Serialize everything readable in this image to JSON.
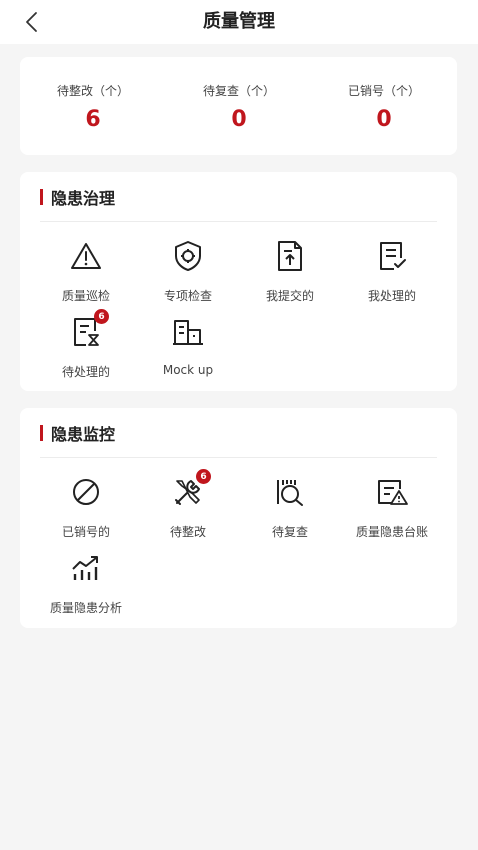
{
  "nav": {
    "title": "质量管理"
  },
  "stats": [
    {
      "label": "待整改（个）",
      "value": "6"
    },
    {
      "label": "待复查（个）",
      "value": "0"
    },
    {
      "label": "已销号（个）",
      "value": "0"
    }
  ],
  "governance": {
    "title": "隐患治理",
    "items": [
      {
        "label": "质量巡检",
        "icon": "warning-triangle-icon"
      },
      {
        "label": "专项检查",
        "icon": "shield-target-icon"
      },
      {
        "label": "我提交的",
        "icon": "document-upload-icon"
      },
      {
        "label": "我处理的",
        "icon": "document-check-icon"
      },
      {
        "label": "待处理的",
        "icon": "document-hourglass-icon",
        "badge": "6"
      },
      {
        "label": "Mock up",
        "icon": "building-icon"
      }
    ]
  },
  "monitoring": {
    "title": "隐患监控",
    "items": [
      {
        "label": "已销号的",
        "icon": "prohibited-icon"
      },
      {
        "label": "待整改",
        "icon": "tools-icon",
        "badge": "6"
      },
      {
        "label": "待复查",
        "icon": "magnifier-icon"
      },
      {
        "label": "质量隐患台账",
        "icon": "ledger-warning-icon"
      },
      {
        "label": "质量隐患分析",
        "icon": "trend-chart-icon"
      }
    ]
  },
  "colors": {
    "accent": "#c0161d",
    "background": "#f5f5f5",
    "card": "#ffffff"
  }
}
